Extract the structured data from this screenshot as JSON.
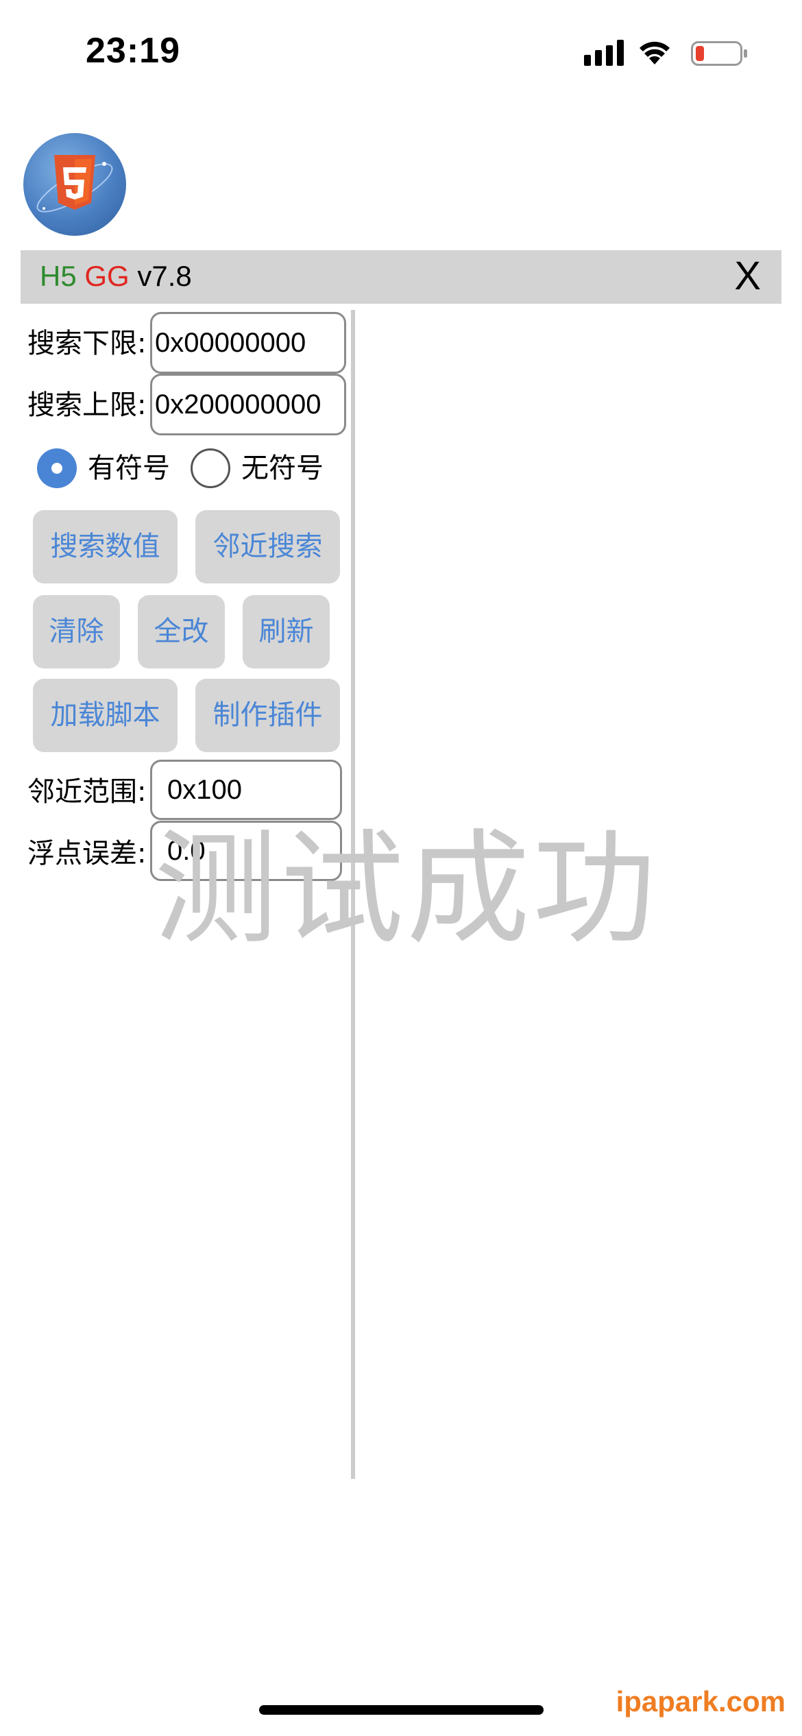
{
  "status_bar": {
    "time": "23:19"
  },
  "titlebar": {
    "h5": "H5",
    "gg": "GG",
    "version": "v7.8",
    "close": "X"
  },
  "search": {
    "lower_label": "搜索下限:",
    "lower_value": "0x00000000",
    "upper_label": "搜索上限:",
    "upper_value": "0x200000000"
  },
  "sign_options": [
    {
      "label": "有符号",
      "checked": true
    },
    {
      "label": "无符号",
      "checked": false
    }
  ],
  "buttons": {
    "search_value": "搜索数值",
    "nearby_search": "邻近搜索",
    "clear": "清除",
    "modify_all": "全改",
    "refresh": "刷新",
    "load_script": "加载脚本",
    "make_plugin": "制作插件"
  },
  "nearby": {
    "label": "邻近范围:",
    "value": "0x100"
  },
  "float_error": {
    "label": "浮点误差:",
    "value": "0.0"
  },
  "overlay_text": "测试成功",
  "site_watermark": "ipapark.com",
  "colors": {
    "accent": "#4a84d4",
    "button_text": "#4a86d6",
    "h5": "#2e8b2e",
    "gg": "#e0261f"
  }
}
